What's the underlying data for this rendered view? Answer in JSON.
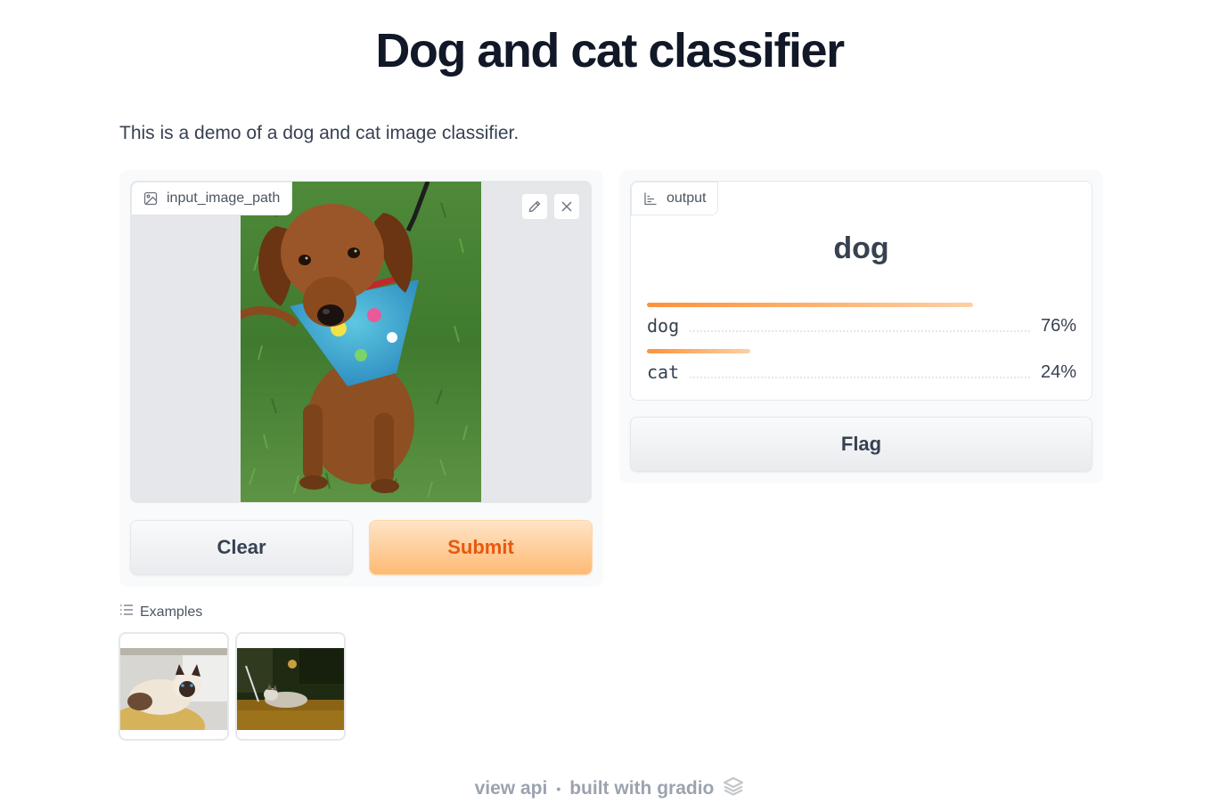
{
  "title": "Dog and cat classifier",
  "description": "This is a demo of a dog and cat image classifier.",
  "input": {
    "label": "input_image_path",
    "icon": "image-icon",
    "tools": [
      "edit-icon",
      "close-icon"
    ]
  },
  "buttons": {
    "clear": "Clear",
    "submit": "Submit",
    "flag": "Flag"
  },
  "output": {
    "label": "output",
    "icon": "bar-chart-icon",
    "prediction": "dog",
    "confidences": [
      {
        "label": "dog",
        "value": "76%",
        "fraction": 0.76
      },
      {
        "label": "cat",
        "value": "24%",
        "fraction": 0.24
      }
    ]
  },
  "examples": {
    "label": "Examples",
    "icon": "list-icon",
    "items": [
      {
        "name": "siamese-cat-thumbnail"
      },
      {
        "name": "cat-on-floor-thumbnail"
      }
    ]
  },
  "footer": {
    "view_api": "view api",
    "separator": "•",
    "built_with": "built with gradio",
    "icon": "gradio-logo-icon"
  },
  "colors": {
    "accent": "#fb923c",
    "submit_text": "#ea580c"
  }
}
